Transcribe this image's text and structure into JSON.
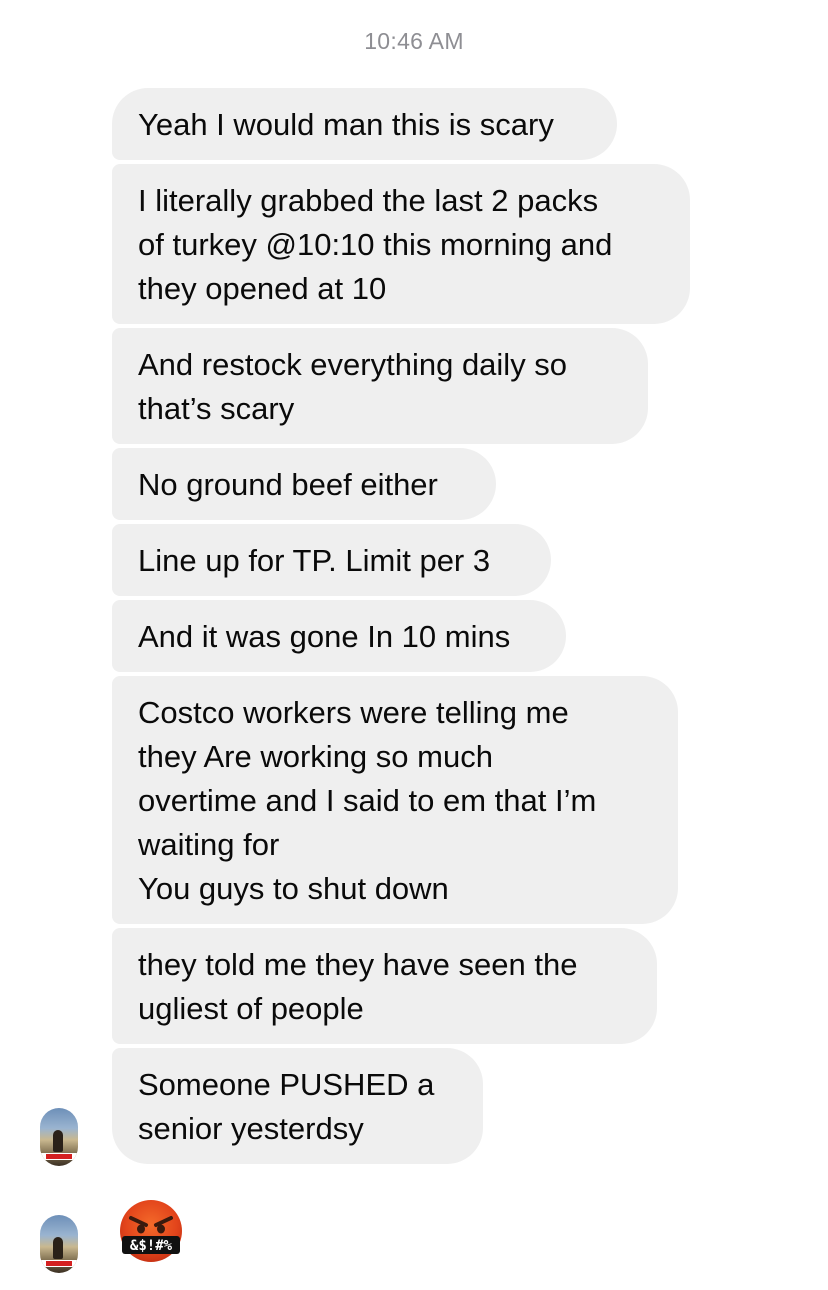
{
  "timestamp": "10:46 AM",
  "messages": [
    "Yeah I would man this is scary",
    "I literally grabbed the last 2 packs\nof turkey @10:10 this morning and\nthey opened at 10",
    "And restock everything daily so\nthat’s scary",
    "No ground beef either",
    "Line up for TP. Limit per 3",
    "And it was gone In 10 mins",
    "Costco workers were telling me\nthey Are working so much\novertime and I said to em that I’m\nwaiting for\nYou guys to shut down",
    "they told me they have seen the\nugliest of people",
    "Someone PUSHED a\nsenior yesterdsy"
  ],
  "reaction_emoji": {
    "icon": "angry-face-with-symbols-icon",
    "symbols_text": "&$!#%"
  },
  "colors": {
    "bubble_bg": "#efefef",
    "timestamp": "#8e8e93",
    "emoji_face": "#e8491d"
  }
}
